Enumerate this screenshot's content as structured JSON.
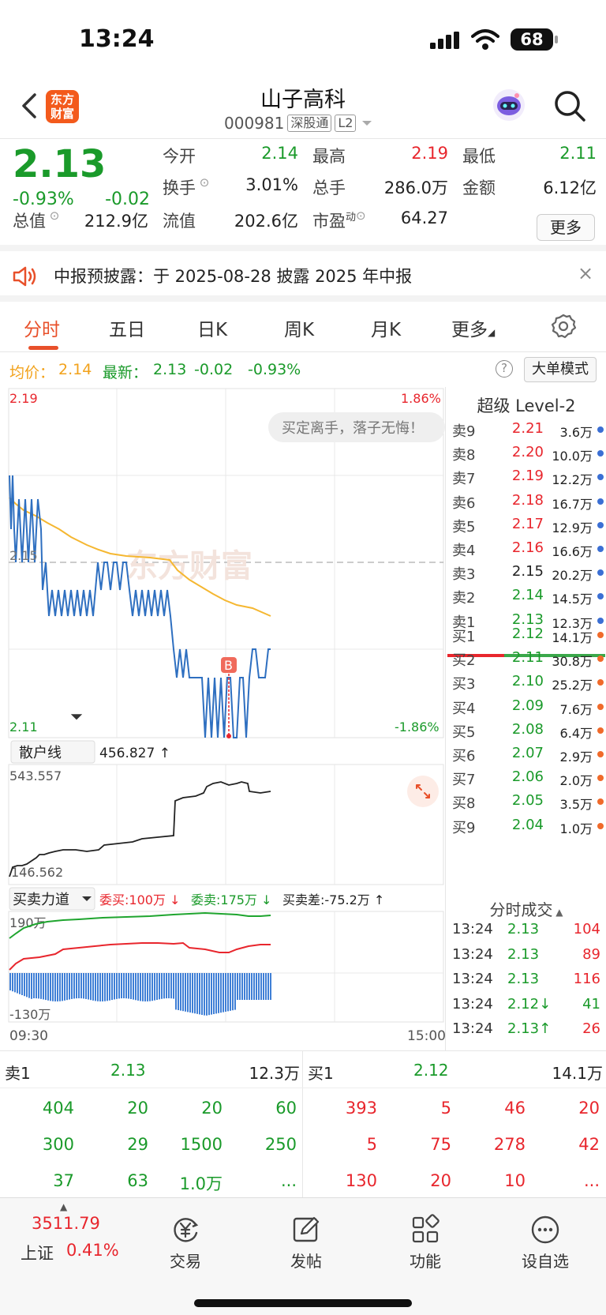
{
  "status_bar": {
    "time": "13:24",
    "battery": "68"
  },
  "header": {
    "logo_text_1": "东方",
    "logo_text_2": "财富",
    "stock_name": "山子高科",
    "stock_code": "000981",
    "tag_connect": "深股通",
    "tag_level": "L2"
  },
  "quote": {
    "price": "2.13",
    "change_pct": "-0.93%",
    "change_abs": "-0.02",
    "fields": [
      {
        "label": "今开",
        "value": "2.14",
        "color": "green"
      },
      {
        "label": "最高",
        "value": "2.19",
        "color": "red"
      },
      {
        "label": "最低",
        "value": "2.11",
        "color": "green"
      },
      {
        "label": "换手",
        "value": "3.01%",
        "color": "black"
      },
      {
        "label": "总手",
        "value": "286.0万",
        "color": "black"
      },
      {
        "label": "金额",
        "value": "6.12亿",
        "color": "black"
      },
      {
        "label": "总值",
        "value": "212.9亿",
        "color": "black"
      },
      {
        "label": "流值",
        "value": "202.6亿",
        "color": "black"
      },
      {
        "label": "市盈",
        "value": "64.27",
        "color": "black"
      }
    ],
    "pe_superscript": "动",
    "more_label": "更多"
  },
  "notice": {
    "text": "中报预披露：于 2025-08-28 披露 2025 年中报",
    "close": "×"
  },
  "tabs": [
    "分时",
    "五日",
    "日K",
    "周K",
    "月K",
    "更多"
  ],
  "avg_row": {
    "avg_label": "均价：",
    "avg_value": "2.14",
    "latest_label": "最新：",
    "latest_value": "2.13",
    "latest_chg": "-0.02",
    "latest_pct": "-0.93%",
    "help": "?",
    "big_order": "大单模式"
  },
  "chart": {
    "price_top": "2.19",
    "price_mid": "2.15",
    "price_bottom": "2.11",
    "pct_top": "1.86%",
    "pct_bottom": "-1.86%",
    "watermark": "东方财富",
    "bubble": "买定离手，落子无悔！",
    "marker": "B",
    "retail_label": "散户线",
    "retail_value": "456.827 ↑",
    "retail_max": "543.557",
    "retail_min": "146.562",
    "force_label": "买卖力道",
    "force_buy": "委买:100万 ↓",
    "force_sell": "委卖:175万 ↓",
    "force_diff": "买卖差:-75.2万 ↑",
    "force_max": "190万",
    "force_min": "-130万",
    "time_start": "09:30",
    "time_end": "15:00"
  },
  "level2": {
    "title": "超级 Level-2",
    "asks": [
      {
        "label": "卖9",
        "price": "2.21",
        "vol": "3.6万",
        "color": "red"
      },
      {
        "label": "卖8",
        "price": "2.20",
        "vol": "10.0万",
        "color": "red"
      },
      {
        "label": "卖7",
        "price": "2.19",
        "vol": "12.2万",
        "color": "red"
      },
      {
        "label": "卖6",
        "price": "2.18",
        "vol": "16.7万",
        "color": "red"
      },
      {
        "label": "卖5",
        "price": "2.17",
        "vol": "12.9万",
        "color": "red"
      },
      {
        "label": "卖4",
        "price": "2.16",
        "vol": "16.6万",
        "color": "red"
      },
      {
        "label": "卖3",
        "price": "2.15",
        "vol": "20.2万",
        "color": "black"
      },
      {
        "label": "卖2",
        "price": "2.14",
        "vol": "14.5万",
        "color": "green"
      },
      {
        "label": "卖1",
        "price": "2.13",
        "vol": "12.3万",
        "color": "green"
      }
    ],
    "bids": [
      {
        "label": "买1",
        "price": "2.12",
        "vol": "14.1万",
        "color": "green"
      },
      {
        "label": "买2",
        "price": "2.11",
        "vol": "30.8万",
        "color": "green"
      },
      {
        "label": "买3",
        "price": "2.10",
        "vol": "25.2万",
        "color": "green"
      },
      {
        "label": "买4",
        "price": "2.09",
        "vol": "7.6万",
        "color": "green"
      },
      {
        "label": "买5",
        "price": "2.08",
        "vol": "6.4万",
        "color": "green"
      },
      {
        "label": "买6",
        "price": "2.07",
        "vol": "2.9万",
        "color": "green"
      },
      {
        "label": "买7",
        "price": "2.06",
        "vol": "2.0万",
        "color": "green"
      },
      {
        "label": "买8",
        "price": "2.05",
        "vol": "3.5万",
        "color": "green"
      },
      {
        "label": "买9",
        "price": "2.04",
        "vol": "1.0万",
        "color": "green"
      }
    ],
    "trades_title": "分时成交",
    "trades": [
      {
        "time": "13:24",
        "price": "2.13",
        "vol": "104",
        "color": "red"
      },
      {
        "time": "13:24",
        "price": "2.13",
        "vol": "89",
        "color": "red"
      },
      {
        "time": "13:24",
        "price": "2.13",
        "vol": "116",
        "color": "red"
      },
      {
        "time": "13:24",
        "price": "2.12↓",
        "vol": "41",
        "color": "green"
      },
      {
        "time": "13:24",
        "price": "2.13↑",
        "vol": "26",
        "color": "red"
      }
    ]
  },
  "queue": {
    "sell_label": "卖1",
    "sell_price": "2.13",
    "sell_vol": "12.3万",
    "buy_label": "买1",
    "buy_price": "2.12",
    "buy_vol": "14.1万",
    "sell_cells": [
      [
        "404",
        "20",
        "20",
        "60"
      ],
      [
        "300",
        "29",
        "1500",
        "250"
      ],
      [
        "37",
        "63",
        "1.0万",
        "..."
      ]
    ],
    "buy_cells": [
      [
        "393",
        "5",
        "46",
        "20"
      ],
      [
        "5",
        "75",
        "278",
        "42"
      ],
      [
        "130",
        "20",
        "10",
        "..."
      ]
    ]
  },
  "bottom_nav": {
    "index_value": "3511.79",
    "index_name": "上证",
    "index_pct": "0.41%",
    "items": [
      "交易",
      "发帖",
      "功能",
      "设自选"
    ]
  }
}
